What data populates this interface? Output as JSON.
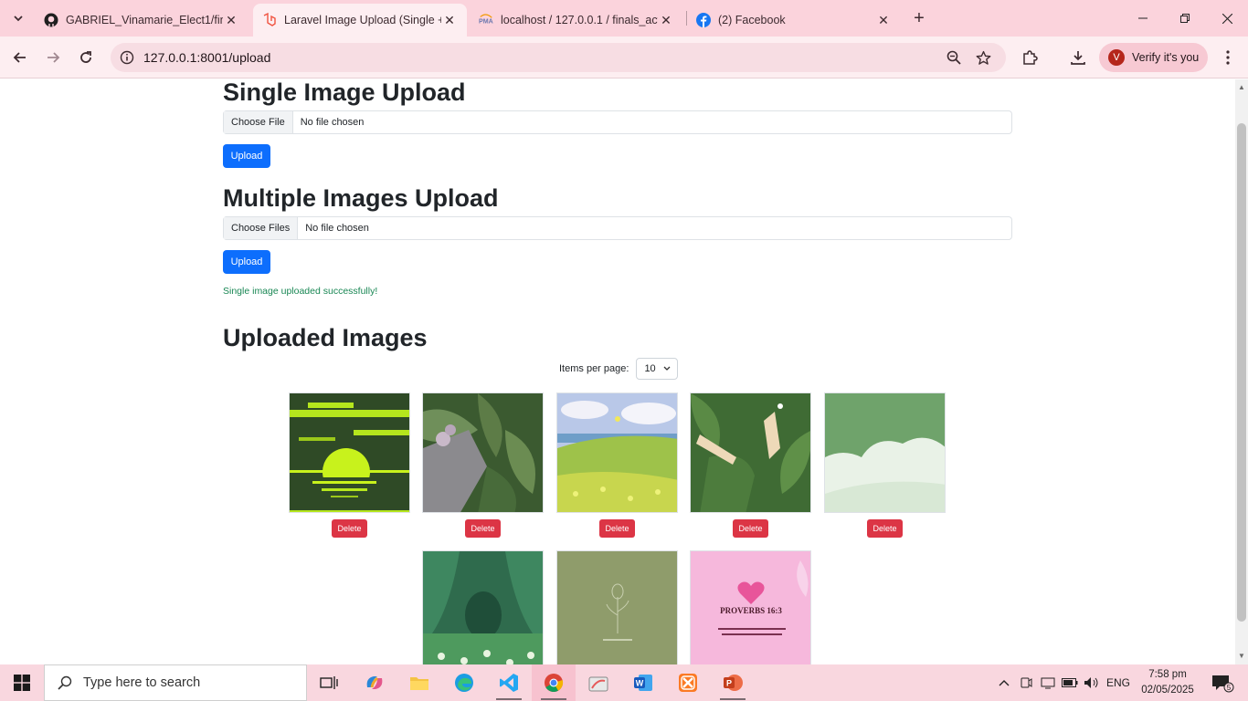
{
  "browser": {
    "tabs": [
      {
        "title": "GABRIEL_Vinamarie_Elect1/final",
        "favicon": "github-icon",
        "active": false
      },
      {
        "title": "Laravel Image Upload (Single +",
        "favicon": "laravel-icon",
        "active": true
      },
      {
        "title": "localhost / 127.0.0.1 / finals_act",
        "favicon": "phpmyadmin-icon",
        "active": false
      },
      {
        "title": "(2) Facebook",
        "favicon": "facebook-icon",
        "active": false
      }
    ],
    "url": "127.0.0.1:8001/upload",
    "verify_label": "Verify it's you",
    "verify_avatar": "V",
    "accent": "#fbd3dc"
  },
  "page": {
    "single": {
      "heading": "Single Image Upload",
      "choose_label": "Choose File",
      "file_status": "No file chosen",
      "upload_label": "Upload"
    },
    "multiple": {
      "heading": "Multiple Images Upload",
      "choose_label": "Choose Files",
      "file_status": "No file chosen",
      "upload_label": "Upload"
    },
    "success_message": "Single image uploaded successfully!",
    "gallery": {
      "heading": "Uploaded Images",
      "items_per_page_label": "Items per page:",
      "items_per_page_value": "10",
      "delete_label": "Delete",
      "images": [
        {
          "name": "pixel-sunset"
        },
        {
          "name": "leaves-flower"
        },
        {
          "name": "meadow-sky"
        },
        {
          "name": "hands-leaves"
        },
        {
          "name": "green-cloud"
        },
        {
          "name": "forest-path"
        },
        {
          "name": "olive-flower"
        },
        {
          "name": "proverbs-pink",
          "text": "PROVERBS 16:3"
        }
      ]
    },
    "colors": {
      "primary": "#0d6efd",
      "danger": "#dc3545",
      "success": "#198754"
    }
  },
  "taskbar": {
    "search_placeholder": "Type here to search",
    "language": "ENG",
    "time": "7:58 pm",
    "date": "02/05/2025",
    "notification_count": "5"
  }
}
